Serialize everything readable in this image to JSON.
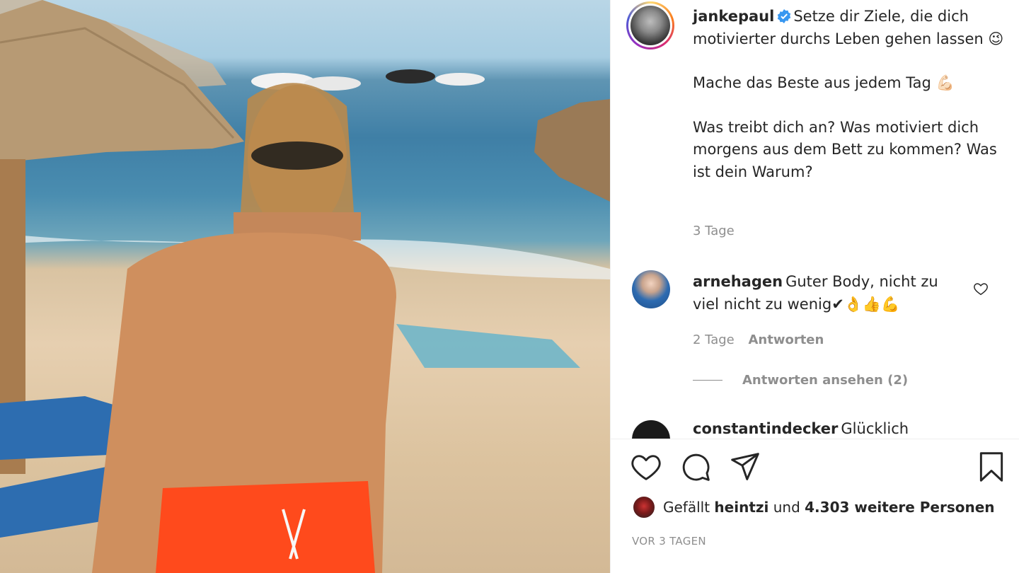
{
  "post": {
    "username": "jankepaul",
    "caption_line1": "Setze dir Ziele, die dich motivierter durchs Leben gehen lassen",
    "caption_emoji1": "😉",
    "caption_para2": "Mache das Beste aus jedem Tag 💪🏻",
    "caption_para3": "Was treibt dich an? Was motiviert dich morgens aus dem Bett zu kommen? Was ist dein Warum?",
    "caption_time": "3 Tage"
  },
  "comments": [
    {
      "username": "arnehagen",
      "text": "Guter Body, nicht zu viel nicht zu wenig",
      "emojis": "✔👌👍💪",
      "time": "2 Tage",
      "reply_label": "Antworten",
      "view_replies": "Antworten ansehen (2)"
    },
    {
      "username": "constantindecker",
      "text": "Glücklich"
    }
  ],
  "likes": {
    "prefix": "Gefällt",
    "user": "heintzi",
    "middle": "und",
    "count": "4.303 weitere Personen"
  },
  "date": "VOR 3 TAGEN",
  "icons": {
    "like": "heart-icon",
    "comment": "comment-icon",
    "share": "paper-plane-icon",
    "save": "bookmark-icon",
    "verified": "verified-badge-icon"
  },
  "colors": {
    "verified": "#3897f0",
    "text": "#262626",
    "muted": "#8e8e8e"
  }
}
